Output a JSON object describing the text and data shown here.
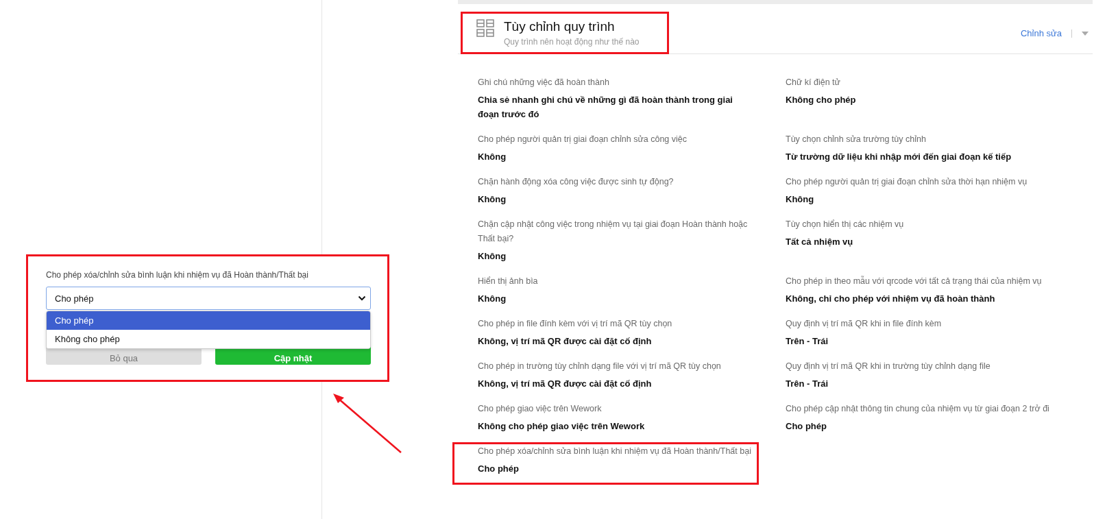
{
  "popup": {
    "highlighted": true,
    "label": "Cho phép xóa/chỉnh sửa bình luận khi nhiệm vụ đã Hoàn thành/Thất bại",
    "value": "Cho phép",
    "options": [
      {
        "label": "Cho phép",
        "selected": true
      },
      {
        "label": "Không cho phép",
        "selected": false
      }
    ],
    "buttons": [
      {
        "label": "Bỏ qua",
        "kind": "secondary"
      },
      {
        "label": "Cập nhật",
        "kind": "primary"
      }
    ]
  },
  "card": {
    "header": {
      "highlighted": true,
      "title": "Tùy chỉnh quy trình",
      "subtitle": "Quy trình nên hoạt động như thế nào",
      "edit_link": "Chỉnh sửa"
    },
    "settings": [
      {
        "label": "Ghi chú những việc đã hoàn thành",
        "value": "Chia sẻ nhanh ghi chú về những gì đã hoàn thành trong giai đoạn trước đó",
        "highlighted": false
      },
      {
        "label": "Chữ kí điện tử",
        "value": "Không cho phép",
        "highlighted": false
      },
      {
        "label": "Cho phép người quản trị giai đoạn chỉnh sửa công việc",
        "value": "Không",
        "highlighted": false
      },
      {
        "label": "Tùy chọn chỉnh sửa trường tùy chỉnh",
        "value": "Từ trường dữ liệu khi nhập mới đến giai đoạn kế tiếp",
        "highlighted": false
      },
      {
        "label": "Chặn hành động xóa công việc được sinh tự động?",
        "value": "Không",
        "highlighted": false
      },
      {
        "label": "Cho phép người quản trị giai đoạn chỉnh sửa thời hạn nhiệm vụ",
        "value": "Không",
        "highlighted": false
      },
      {
        "label": "Chặn cập nhật công việc trong nhiệm vụ tại giai đoạn Hoàn thành hoặc Thất bại?",
        "value": "Không",
        "highlighted": false
      },
      {
        "label": "Tùy chọn hiển thị các nhiệm vụ",
        "value": "Tất cả nhiệm vụ",
        "highlighted": false
      },
      {
        "label": "Hiển thị ảnh bìa",
        "value": "Không",
        "highlighted": false
      },
      {
        "label": "Cho phép in theo mẫu với qrcode với tất cả trạng thái của nhiệm vụ",
        "value": "Không, chỉ cho phép với nhiệm vụ đã hoàn thành",
        "highlighted": false
      },
      {
        "label": "Cho phép in file đính kèm với vị trí mã QR tùy chọn",
        "value": "Không, vị trí mã QR được cài đặt cố định",
        "highlighted": false
      },
      {
        "label": "Quy định vị trí mã QR khi in file đính kèm",
        "value": "Trên - Trái",
        "highlighted": false
      },
      {
        "label": "Cho phép in trường tùy chỉnh dạng file với vị trí mã QR tùy chọn",
        "value": "Không, vị trí mã QR được cài đặt cố định",
        "highlighted": false
      },
      {
        "label": "Quy định vị trí mã QR khi in trường tùy chỉnh dạng file",
        "value": "Trên - Trái",
        "highlighted": false
      },
      {
        "label": "Cho phép giao việc trên Wework",
        "value": "Không cho phép giao việc trên Wework",
        "highlighted": false
      },
      {
        "label": "Cho phép cập nhật thông tin chung của nhiệm vụ từ giai đoạn 2 trở đi",
        "value": "Cho phép",
        "highlighted": false
      },
      {
        "label": "Cho phép xóa/chỉnh sửa bình luận khi nhiệm vụ đã Hoàn thành/Thất bại",
        "value": "Cho phép",
        "highlighted": true
      }
    ]
  }
}
